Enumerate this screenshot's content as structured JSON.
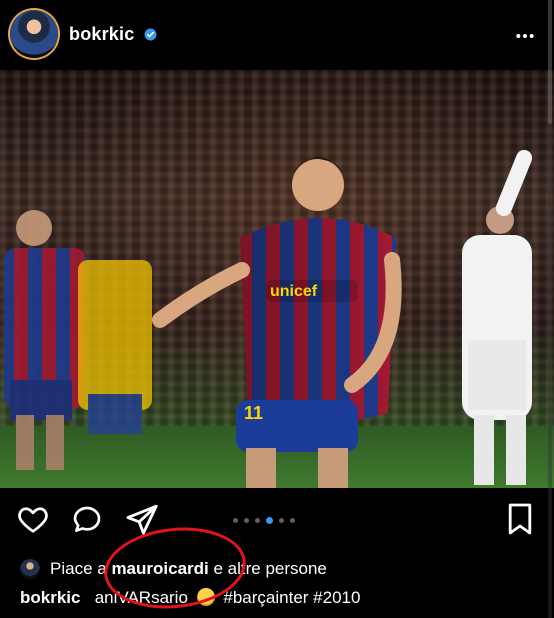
{
  "header": {
    "username": "bokrkic",
    "verified_icon": "verified-badge-icon",
    "more_icon": "more-dots-icon"
  },
  "photo": {
    "jersey_sponsor": "unicef",
    "jersey_number": "11"
  },
  "actions": {
    "like_icon": "heart-outline-icon",
    "comment_icon": "comment-bubble-icon",
    "share_icon": "paper-plane-icon",
    "save_icon": "bookmark-outline-icon",
    "carousel": {
      "dots": 6,
      "active_index": 2
    }
  },
  "likes": {
    "prefix": "Piace a",
    "user": "mauroicardi",
    "suffix": "e altre persone"
  },
  "caption": {
    "username": "bokrkic",
    "text_part1": "aniVARsario",
    "text_part2": "#barçainter #2010"
  },
  "colors": {
    "accent": "#3897f0",
    "annotation": "#e2141b",
    "background": "#000000",
    "text": "#ffffff"
  }
}
